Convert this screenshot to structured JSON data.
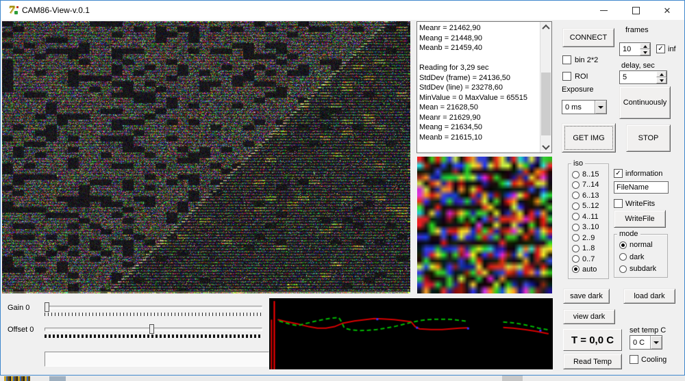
{
  "window": {
    "title": "CAM86-View-v.0.1",
    "minimize_label": "minimize",
    "maximize_label": "maximize",
    "close_label": "close"
  },
  "colors": {
    "window_border": "#3f87cc",
    "titlebar_bg": "#ffffff",
    "app_bg": "#f0f0f0",
    "graph_bg": "#000000",
    "graph_red": "#d80000",
    "graph_green": "#00b800"
  },
  "log": {
    "lines": [
      "Meanr = 21462,90",
      "Meang = 21448,90",
      "Meanb = 21459,40",
      "",
      "Reading for 3,29 sec",
      "StdDev (frame) = 24136,50",
      "StdDev (line) = 23278,60",
      "MinValue = 0 MaxValue = 65515",
      "Mean = 21628,50",
      "Meanr = 21629,90",
      "Meang = 21634,50",
      "Meanb = 21615,10"
    ]
  },
  "panel": {
    "connect_label": "CONNECT",
    "frames_label": "frames",
    "frames_value": "10",
    "inf_label": "inf",
    "bin22_label": "bin 2*2",
    "roi_label": "ROI",
    "delay_label": "delay, sec",
    "delay_value": "5",
    "exposure_label": "Exposure",
    "exposure_value": "0 ms",
    "continuously_label": "Continuously",
    "getimg_label": "GET IMG",
    "stop_label": "STOP"
  },
  "states": {
    "inf_checked": true,
    "bin22_checked": false,
    "roi_checked": false,
    "information_checked": true,
    "writefits_checked": false,
    "cooling_checked": false
  },
  "iso": {
    "label": "iso",
    "options": [
      "8..15",
      "7..14",
      "6..13",
      "5..12",
      "4..11",
      "3..10",
      "2..9",
      "1..8",
      "0..7",
      "auto"
    ],
    "selected_index": 9
  },
  "output": {
    "information_label": "information",
    "filename_value": "FileName",
    "writefits_label": "WriteFits",
    "writefile_label": "WriteFile"
  },
  "mode": {
    "label": "mode",
    "options": [
      "normal",
      "dark",
      "subdark"
    ],
    "selected_index": 0
  },
  "darks": {
    "save_label": "save dark",
    "load_label": "load dark",
    "view_label": "view dark"
  },
  "temp": {
    "display": "T = 0,0 C",
    "set_label": "set temp C",
    "set_value": "0 C",
    "read_label": "Read Temp",
    "cooling_label": "Cooling"
  },
  "sliders": {
    "gain_label": "Gain 0",
    "offset_label": "Offset 0",
    "gain_pos": 0.005,
    "offset_pos": 0.49
  },
  "chart_data": {
    "type": "line",
    "title": "",
    "description": "RGB row intensity profiles of captured frame on black background; red and green (dashed) traces with data gap near right side and red spike at left edge",
    "bg": "#000000",
    "grid": false,
    "legend": "none",
    "x_range": [
      0,
      1
    ],
    "y_range": [
      0,
      1
    ],
    "series": [
      {
        "name": "red-profile",
        "color": "#d80000",
        "dash": [],
        "points": [
          [
            0.03,
            0.3
          ],
          [
            0.06,
            0.33
          ],
          [
            0.1,
            0.36
          ],
          [
            0.14,
            0.4
          ],
          [
            0.17,
            0.42
          ],
          [
            0.2,
            0.42
          ],
          [
            0.23,
            0.4
          ],
          [
            0.26,
            0.35
          ],
          [
            0.3,
            0.32
          ],
          [
            0.34,
            0.3
          ],
          [
            0.37,
            0.285
          ],
          [
            0.4,
            0.29
          ],
          [
            0.44,
            0.3
          ],
          [
            0.47,
            0.315
          ],
          [
            0.5,
            0.33
          ],
          [
            0.515,
            0.4
          ],
          [
            0.53,
            0.43
          ],
          [
            0.57,
            0.44
          ],
          [
            0.61,
            0.44
          ],
          [
            0.64,
            0.43
          ],
          [
            0.67,
            0.42
          ],
          [
            0.7,
            0.415
          ]
        ]
      },
      {
        "name": "red-profile-right",
        "color": "#d80000",
        "dash": [],
        "points": [
          [
            0.825,
            0.41
          ],
          [
            0.86,
            0.42
          ],
          [
            0.9,
            0.44
          ],
          [
            0.94,
            0.465
          ],
          [
            0.985,
            0.5
          ]
        ]
      },
      {
        "name": "green-profile",
        "color": "#00b800",
        "dash": [
          6,
          4
        ],
        "points": [
          [
            0.035,
            0.32
          ],
          [
            0.07,
            0.36
          ],
          [
            0.1,
            0.385
          ],
          [
            0.125,
            0.36
          ],
          [
            0.155,
            0.33
          ],
          [
            0.19,
            0.3
          ],
          [
            0.22,
            0.28
          ],
          [
            0.245,
            0.27
          ],
          [
            0.255,
            0.33
          ],
          [
            0.265,
            0.42
          ],
          [
            0.29,
            0.445
          ],
          [
            0.32,
            0.455
          ],
          [
            0.35,
            0.45
          ],
          [
            0.38,
            0.44
          ],
          [
            0.41,
            0.42
          ],
          [
            0.44,
            0.4
          ],
          [
            0.47,
            0.37
          ],
          [
            0.5,
            0.34
          ],
          [
            0.53,
            0.315
          ],
          [
            0.56,
            0.3
          ],
          [
            0.59,
            0.295
          ],
          [
            0.62,
            0.295
          ],
          [
            0.65,
            0.3
          ],
          [
            0.68,
            0.315
          ],
          [
            0.7,
            0.325
          ]
        ]
      },
      {
        "name": "green-profile-right",
        "color": "#00b800",
        "dash": [
          6,
          4
        ],
        "points": [
          [
            0.825,
            0.335
          ],
          [
            0.86,
            0.345
          ],
          [
            0.89,
            0.365
          ],
          [
            0.92,
            0.39
          ],
          [
            0.95,
            0.42
          ],
          [
            0.985,
            0.445
          ]
        ]
      }
    ],
    "spikes": [
      {
        "x": 0.008,
        "y1": 0.3,
        "y2": 1.0,
        "color": "#e00000"
      },
      {
        "x": 0.018,
        "y1": 0.04,
        "y2": 1.0,
        "color": "#ff0000"
      }
    ],
    "markers": [
      {
        "x": 0.38,
        "y": 0.29,
        "color": "#3333ff"
      },
      {
        "x": 0.52,
        "y": 0.41,
        "color": "#3333ff"
      },
      {
        "x": 0.7,
        "y": 0.42,
        "color": "#3333ff"
      },
      {
        "x": 0.955,
        "y": 0.45,
        "color": "#3333ff"
      }
    ]
  }
}
